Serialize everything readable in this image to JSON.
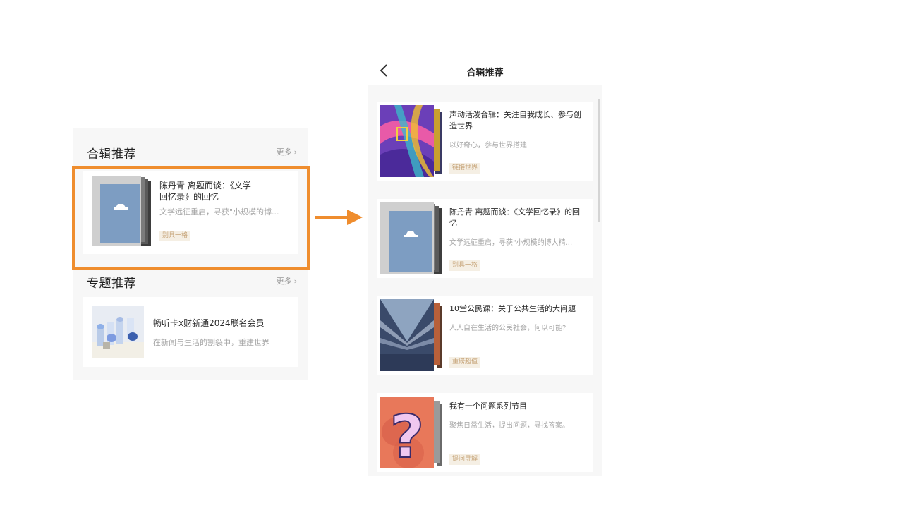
{
  "left": {
    "collections": {
      "title": "合辑推荐",
      "more": "更多",
      "card": {
        "title_line1": "陈丹青 离题而谈：《文学",
        "title_line2": "回忆录》的回忆",
        "desc": "文学远征重启，寻获\"小规模的博...",
        "tag": "别具一格"
      }
    },
    "topics": {
      "title": "专题推荐",
      "more": "更多",
      "card": {
        "title": "畅听卡x财新通2024联名会员",
        "desc": "在新闻与生活的割裂中，重建世界"
      }
    }
  },
  "right": {
    "nav_title": "合辑推荐",
    "items": [
      {
        "title": "声动活泼合辑：关注自我成长、参与创造世界",
        "desc": "以好奇心，参与世界搭建",
        "tag": "链接世界"
      },
      {
        "title": "陈丹青 离题而谈：《文学回忆录》的回忆",
        "desc": "文学远征重启，寻获\"小规模的博大精...",
        "tag": "别具一格"
      },
      {
        "title": "10堂公民课：关于公共生活的大问题",
        "desc": "人人自在生活的公民社会，何以可能?",
        "tag": "重磅超值"
      },
      {
        "title": "我有一个问题系列节目",
        "desc": "聚焦日常生活，提出问题，寻找答案。",
        "tag": "提问寻解"
      }
    ]
  },
  "colors": {
    "highlight": "#ef8d2e",
    "tag_text": "#c7a57a",
    "tag_bg": "#f5efe4",
    "panel_bg": "#f7f7f7"
  },
  "icons": [
    "chevron-right-icon",
    "back-arrow-icon",
    "right-arrow-icon"
  ]
}
